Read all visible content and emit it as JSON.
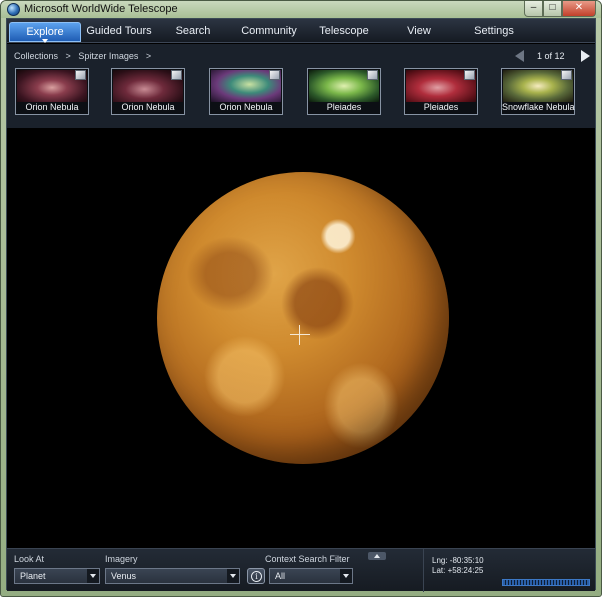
{
  "window": {
    "title": "Microsoft WorldWide Telescope",
    "controls": [
      "–",
      "□",
      "✕"
    ]
  },
  "nav": {
    "tabs": [
      {
        "label": "Explore",
        "active": true
      },
      {
        "label": "Guided Tours"
      },
      {
        "label": "Search"
      },
      {
        "label": "Community"
      },
      {
        "label": "Telescope"
      },
      {
        "label": "View"
      },
      {
        "label": "Settings"
      }
    ]
  },
  "browser": {
    "breadcrumb": [
      "Collections",
      ">",
      "Spitzer Images",
      ">"
    ],
    "pager": "1 of 12",
    "thumbnails": [
      {
        "label": "Orion Nebula",
        "icon": "image-thumbnail"
      },
      {
        "label": "Orion Nebula",
        "icon": "image-thumbnail"
      },
      {
        "label": "Orion Nebula",
        "icon": "image-thumbnail"
      },
      {
        "label": "Pleiades",
        "icon": "image-thumbnail"
      },
      {
        "label": "Pleiades",
        "icon": "image-thumbnail"
      },
      {
        "label": "Snowflake Nebula",
        "icon": "image-thumbnail"
      }
    ]
  },
  "viewport": {
    "object": "venus-planet-icon",
    "reticle": "crosshair-icon"
  },
  "bottom": {
    "look_at_label": "Look At",
    "look_at_value": "Planet",
    "imagery_label": "Imagery",
    "imagery_value": "Venus",
    "filter_label": "Context Search Filter",
    "filter_value": "All",
    "info_glyph": "i",
    "lng": "Lng:  -80:35:10",
    "lat": "Lat:  +58:24:25"
  },
  "colors": {
    "accent": "#2f7fd9",
    "background": "#000000",
    "planet": "#cf8a2e"
  }
}
